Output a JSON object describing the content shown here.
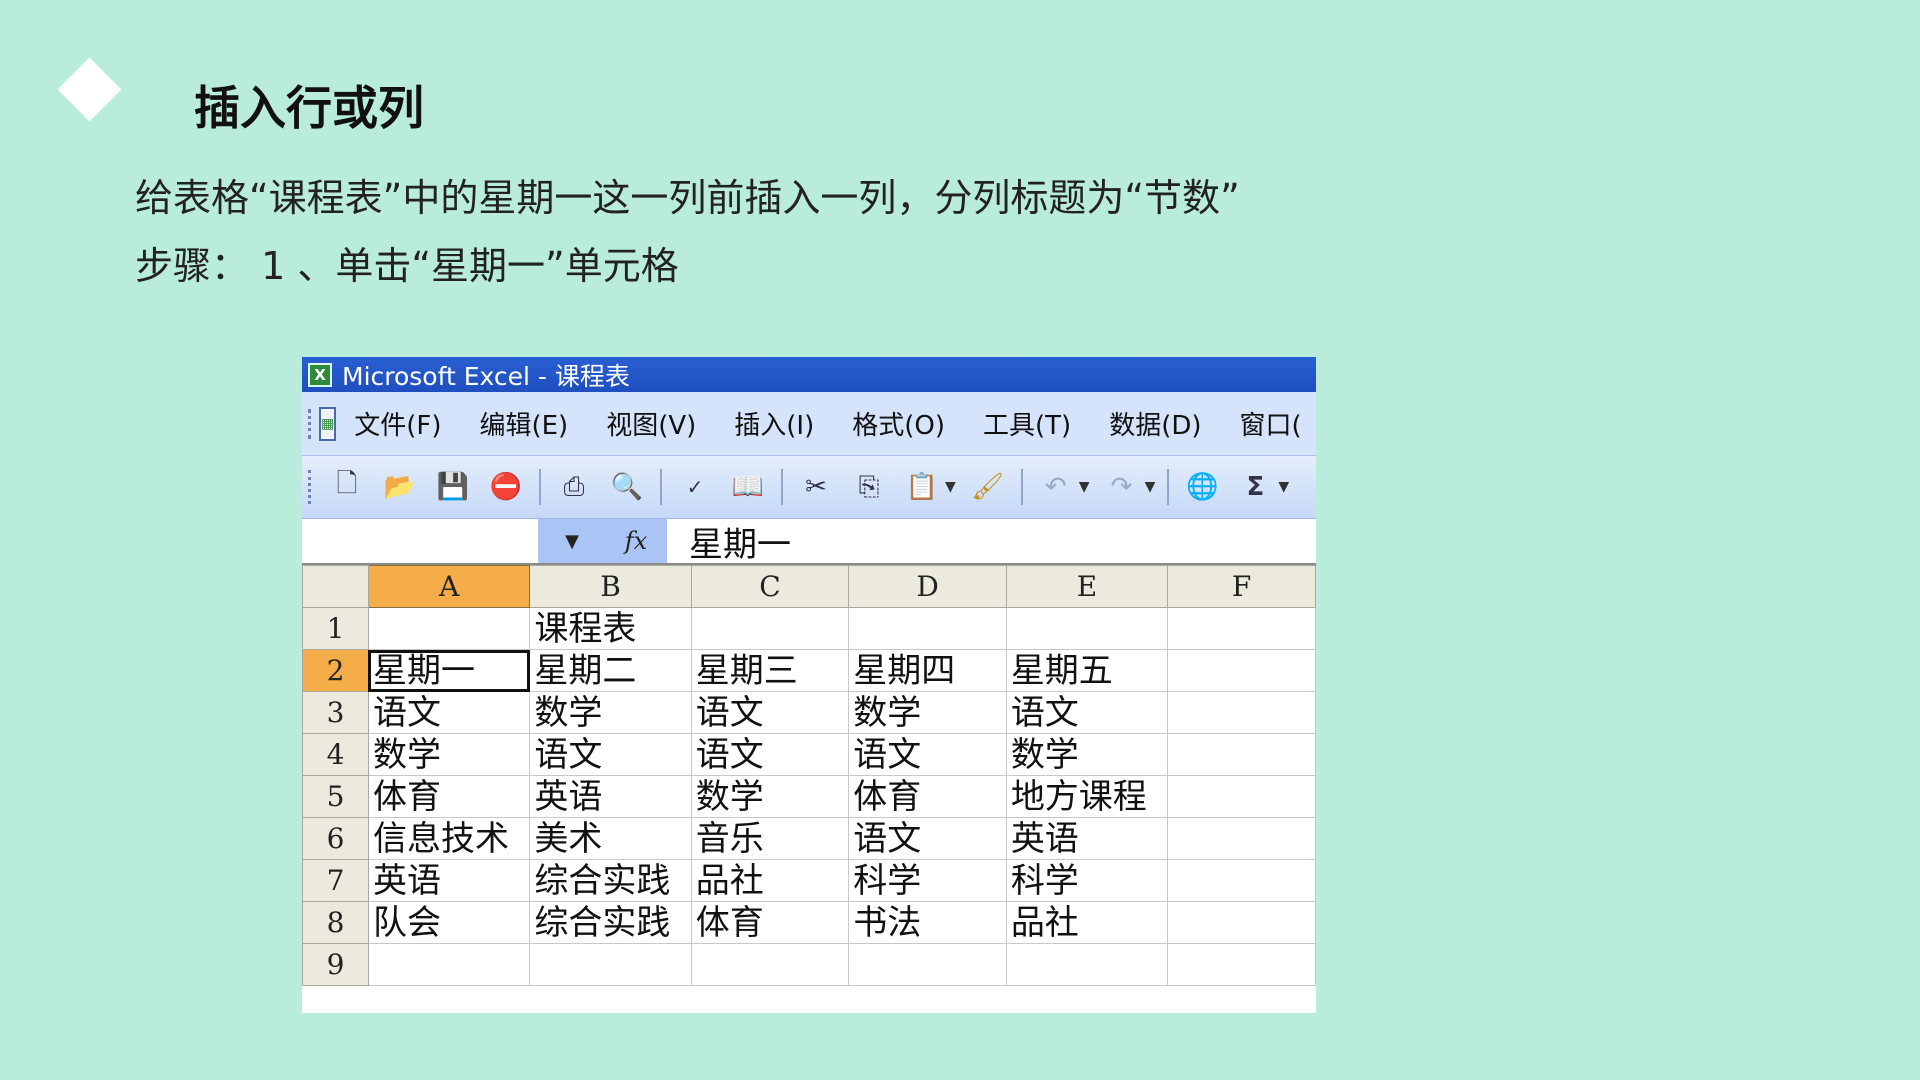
{
  "slide": {
    "title": "插入行或列",
    "line1": "给表格“课程表”中的星期一这一列前插入一列，分列标题为“节数”",
    "line2": "步骤： 1 、单击“星期一”单元格"
  },
  "excel": {
    "window_title": "Microsoft Excel - 课程表",
    "menus": [
      "文件(F)",
      "编辑(E)",
      "视图(V)",
      "插入(I)",
      "格式(O)",
      "工具(T)",
      "数据(D)",
      "窗口("
    ],
    "toolbar_icons": [
      "new-icon",
      "open-icon",
      "save-icon",
      "permission-icon",
      "print-icon",
      "print-preview-icon",
      "spelling-icon",
      "research-icon",
      "cut-icon",
      "copy-icon",
      "paste-icon",
      "format-painter-icon",
      "undo-icon",
      "redo-icon",
      "hyperlink-icon",
      "autosum-icon"
    ],
    "formula_bar": {
      "name_box": "",
      "fx": "fx",
      "value": "星期一"
    },
    "columns": [
      "A",
      "B",
      "C",
      "D",
      "E",
      "F"
    ],
    "selected_column": "A",
    "selected_row": "2",
    "rows": [
      {
        "n": "1",
        "cells": [
          "",
          "课程表",
          "",
          "",
          "",
          ""
        ]
      },
      {
        "n": "2",
        "cells": [
          "星期一",
          "星期二",
          "星期三",
          "星期四",
          "星期五",
          ""
        ]
      },
      {
        "n": "3",
        "cells": [
          "语文",
          "数学",
          "语文",
          "数学",
          "语文",
          ""
        ]
      },
      {
        "n": "4",
        "cells": [
          "数学",
          "语文",
          "语文",
          "语文",
          "数学",
          ""
        ]
      },
      {
        "n": "5",
        "cells": [
          "体育",
          "英语",
          "数学",
          "体育",
          "地方课程",
          ""
        ]
      },
      {
        "n": "6",
        "cells": [
          "信息技术",
          "美术",
          "音乐",
          "语文",
          "英语",
          ""
        ]
      },
      {
        "n": "7",
        "cells": [
          "英语",
          "综合实践",
          "品社",
          "科学",
          "科学",
          ""
        ]
      },
      {
        "n": "8",
        "cells": [
          "队会",
          "综合实践",
          "体育",
          "书法",
          "品社",
          ""
        ]
      },
      {
        "n": "9",
        "cells": [
          "",
          "",
          "",
          "",
          "",
          ""
        ]
      }
    ],
    "colors": {
      "slide_bg": "#b9ecdb",
      "title_bar": "#2a5fd2",
      "menu_bar": "#d5e3fb",
      "selected_header": "#f5ad4a"
    }
  }
}
